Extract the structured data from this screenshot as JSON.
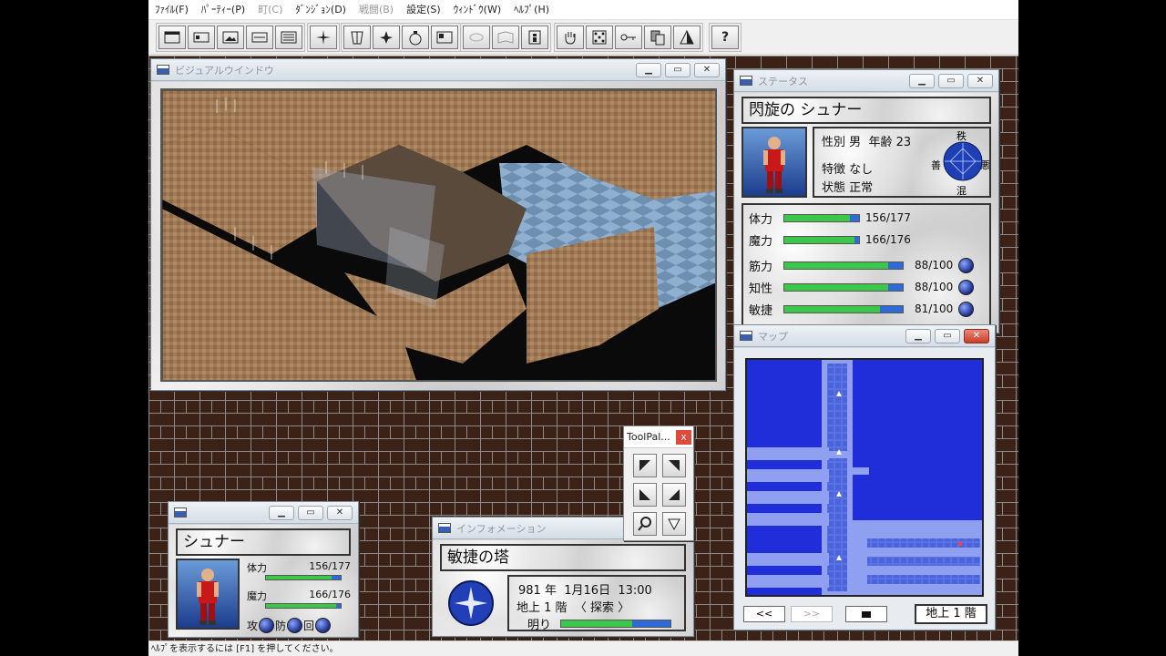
{
  "menu": [
    {
      "label": "ﾌｧｲﾙ(F)",
      "disabled": false
    },
    {
      "label": "ﾊﾟｰﾃｨｰ(P)",
      "disabled": false
    },
    {
      "label": "町(C)",
      "disabled": true
    },
    {
      "label": "ﾀﾞﾝｼﾞｮﾝ(D)",
      "disabled": false
    },
    {
      "label": "戦闘(B)",
      "disabled": true
    },
    {
      "label": "設定(S)",
      "disabled": false
    },
    {
      "label": "ｳｨﾝﾄﾞｳ(W)",
      "disabled": false
    },
    {
      "label": "ﾍﾙﾌﾟ(H)",
      "disabled": false
    }
  ],
  "toolbar": {
    "help_glyph": "?"
  },
  "visual_window": {
    "title": "ビジュアルウインドウ"
  },
  "status_window": {
    "title": "ステータス",
    "char_name": "閃旋の シュナー",
    "gender_label": "性別",
    "gender": "男",
    "age_label": "年齢",
    "age": "23",
    "trait_label": "特徴",
    "trait": "なし",
    "condition_label": "状態",
    "condition": "正常",
    "alignment": {
      "top": "秩",
      "left": "善",
      "right": "悪",
      "bottom": "混"
    },
    "stats": [
      {
        "label": "体力",
        "value": "156/177",
        "fill": 0.88
      },
      {
        "label": "魔力",
        "value": "166/176",
        "fill": 0.94
      },
      {
        "label": "筋力",
        "value": "88/100",
        "fill": 0.88
      },
      {
        "label": "知性",
        "value": "88/100",
        "fill": 0.88
      },
      {
        "label": "敏捷",
        "value": "81/100",
        "fill": 0.81
      }
    ]
  },
  "map_window": {
    "title": "マップ",
    "prev_label": "<<",
    "next_label": ">>",
    "floor_label": "地上 1 階"
  },
  "tool_palette": {
    "title": "ToolPal..."
  },
  "info_window": {
    "title": "インフォメーション",
    "location": "敏捷の塔",
    "year": "981",
    "year_unit": "年",
    "date": "1月16日",
    "time": "13:00",
    "floor": "地上 1 階",
    "mode": "〈 探索 〉",
    "light_label": "明り",
    "light_fill": 0.65
  },
  "char_window": {
    "name": "シュナー",
    "hp_label": "体力",
    "hp": "156/177",
    "hp_fill": 0.88,
    "mp_label": "魔力",
    "mp": "166/176",
    "mp_fill": 0.94,
    "actions": [
      "攻",
      "防",
      "回"
    ]
  },
  "statusbar": "ﾍﾙﾌﾟを表示するには [F1] を押してください。",
  "colors": {
    "map_blue": "#1f2ed8",
    "bar_green": "#3bc84a",
    "bar_blue": "#2e6bd6",
    "brick": "#3c2216"
  }
}
